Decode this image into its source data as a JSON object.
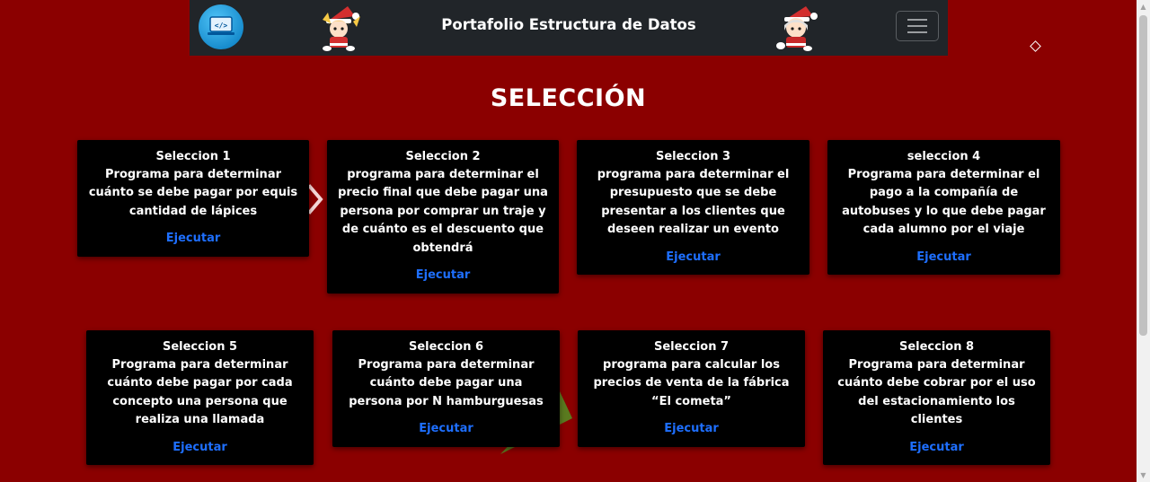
{
  "navbar": {
    "brand": "Portafolio Estructura de Datos",
    "logo_icon": "laptop-code-icon",
    "menu_icon": "hamburger-menu-icon"
  },
  "page": {
    "title": "SELECCIÓN"
  },
  "cards": [
    {
      "title": "Seleccion 1",
      "description": "Programa para determinar cuánto se debe pagar por equis cantidad de lápices",
      "action": "Ejecutar"
    },
    {
      "title": "Seleccion 2",
      "description": "programa para determinar el precio final que debe pagar una persona por comprar un traje y de cuánto es el descuento que obtendrá",
      "action": "Ejecutar"
    },
    {
      "title": "Seleccion 3",
      "description": "programa para determinar el presupuesto que se debe presentar a los clientes que deseen realizar un evento",
      "action": "Ejecutar"
    },
    {
      "title": "seleccion 4",
      "description": "Programa para determinar el pago a la compañía de autobuses y lo que debe pagar cada alumno por el viaje",
      "action": "Ejecutar"
    },
    {
      "title": "Seleccion 5",
      "description": "Programa para determinar cuánto debe pagar por cada concepto una persona que realiza una llamada",
      "action": "Ejecutar"
    },
    {
      "title": "Seleccion 6",
      "description": "Programa para determinar cuánto debe pagar una persona por N hamburguesas",
      "action": "Ejecutar"
    },
    {
      "title": "Seleccion 7",
      "description": "programa para calcular los precios de venta de la fábrica “El cometa”",
      "action": "Ejecutar"
    },
    {
      "title": "Seleccion 8",
      "description": "Programa para determinar cuánto debe cobrar por el uso del estacionamiento los clientes",
      "action": "Ejecutar"
    }
  ],
  "colors": {
    "background": "#8b0000",
    "navbar": "#212529",
    "card": "#000000",
    "link": "#1e6fff"
  }
}
